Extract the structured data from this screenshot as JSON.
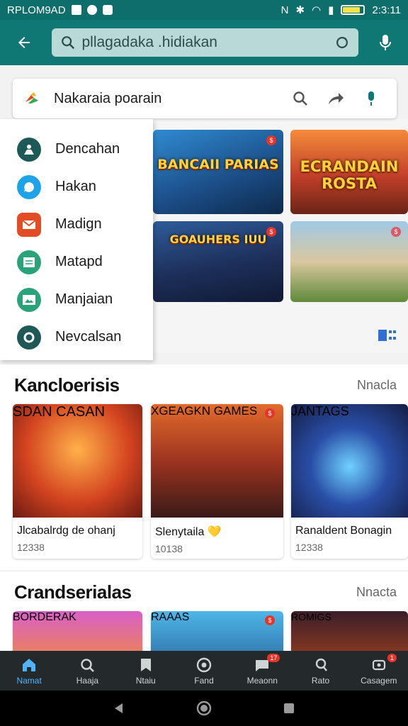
{
  "status_bar": {
    "left_text": "RPLOM9AD",
    "time": "2:3:11"
  },
  "search": {
    "value": "pllagadаka .hidiakan"
  },
  "search_card": {
    "title": "Nakaraia poarain"
  },
  "menu": {
    "items": [
      {
        "label": "Dencahan",
        "icon": "person-icon",
        "color": "#1d5a57"
      },
      {
        "label": "Hakan",
        "icon": "chat-icon",
        "color": "#1ea2e8"
      },
      {
        "label": "Madign",
        "icon": "mail-icon",
        "color": "#e24d26"
      },
      {
        "label": "Matapd",
        "icon": "document-icon",
        "color": "#2aa37a"
      },
      {
        "label": "Manjaian",
        "icon": "image-icon",
        "color": "#2aa37a"
      },
      {
        "label": "Nevcalsan",
        "icon": "circle-icon",
        "color": "#1d5a57"
      }
    ]
  },
  "featured": [
    {
      "art_text": "BANCAII PARIAS"
    },
    {
      "art_text": "ECRANDAIN ROSTA"
    },
    {
      "art_text": "GOAUHERS IUU"
    },
    {
      "art_text": ""
    }
  ],
  "section1": {
    "heading": "Kancloerisis",
    "more": "Nnacla",
    "cards": [
      {
        "art_text": "SDAN CASAN",
        "name": "Jlcabalrdg de ohanj",
        "count": "12338"
      },
      {
        "art_text": "XGEAGKN GAMES",
        "name": "Slenytaila 💛",
        "count": "10138"
      },
      {
        "art_text": "JANTAGS",
        "name": "Ranaldent Bonagin",
        "count": "12338"
      }
    ]
  },
  "section2": {
    "heading": "Crandserialas",
    "more": "Nnacta",
    "cards": [
      {
        "art_text": "BORDERAK"
      },
      {
        "art_text": "RAAAS"
      },
      {
        "art_text": "ROMIGS"
      }
    ]
  },
  "bottom_nav": {
    "items": [
      {
        "label": "Namat",
        "icon": "home-icon",
        "badge": ""
      },
      {
        "label": "Haaja",
        "icon": "search-icon",
        "badge": ""
      },
      {
        "label": "Ntaiu",
        "icon": "bookmark-icon",
        "badge": ""
      },
      {
        "label": "Fand",
        "icon": "play-icon",
        "badge": ""
      },
      {
        "label": "Meaonn",
        "icon": "message-icon",
        "badge": "17"
      },
      {
        "label": "Rato",
        "icon": "profile-icon",
        "badge": ""
      },
      {
        "label": "Casagem",
        "icon": "settings-icon",
        "badge": "1"
      }
    ]
  },
  "colors": {
    "app_bar": "#0f7874",
    "accent": "#4fb3ff",
    "badge": "#e5352b"
  }
}
